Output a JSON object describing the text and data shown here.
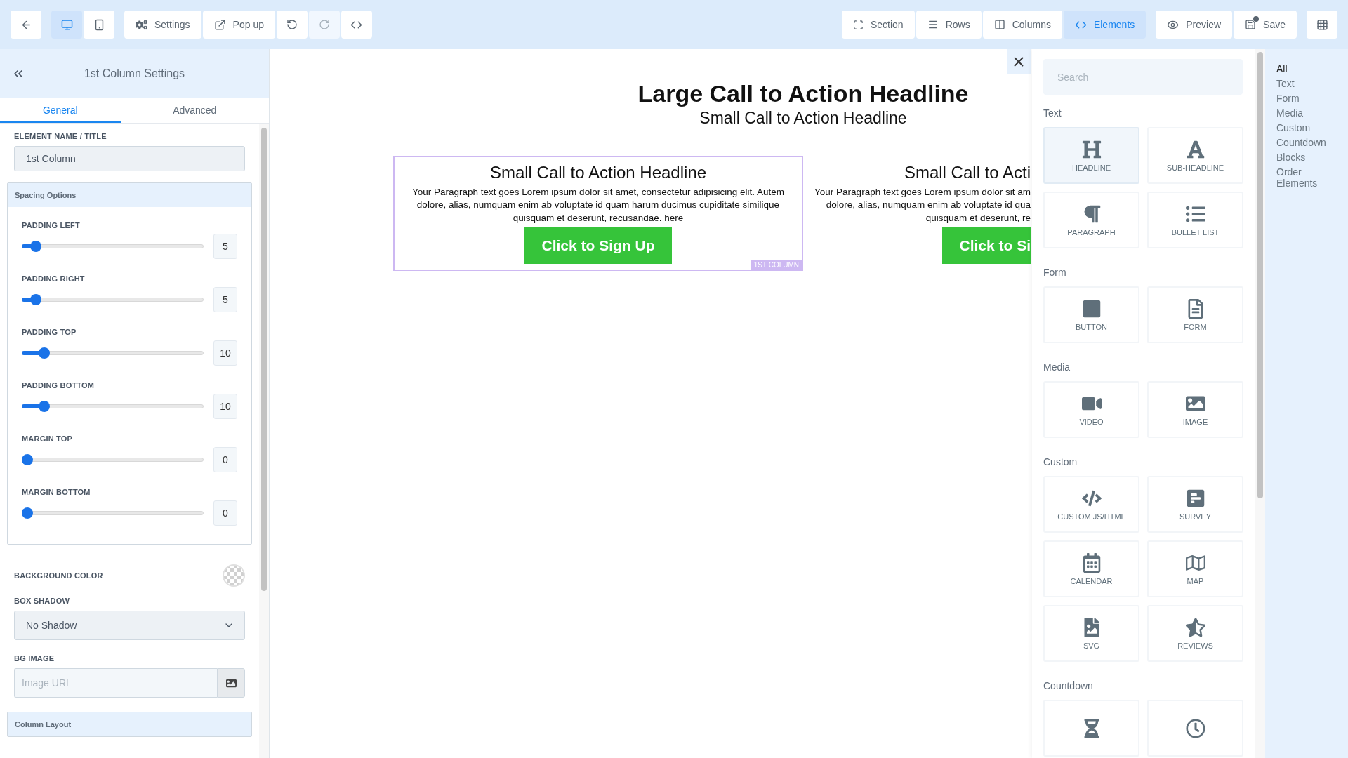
{
  "toolbar": {
    "devices": [
      {
        "kind": "desktop",
        "selected": true
      },
      {
        "kind": "mobile",
        "selected": false
      }
    ],
    "actions": [
      {
        "kind": "settings",
        "label": "Settings",
        "disabled": false
      },
      {
        "kind": "popup",
        "label": "Pop up",
        "disabled": false
      },
      {
        "kind": "undo",
        "disabled": false
      },
      {
        "kind": "redo",
        "disabled": true
      },
      {
        "kind": "code",
        "disabled": false
      }
    ],
    "modes": [
      {
        "kind": "section",
        "label": "Section",
        "selected": false
      },
      {
        "kind": "rows",
        "label": "Rows",
        "selected": false
      },
      {
        "kind": "columns",
        "label": "Columns",
        "selected": false
      },
      {
        "kind": "elements",
        "label": "Elements",
        "selected": true
      }
    ],
    "preview": {
      "label": "Preview"
    },
    "save": {
      "label": "Save",
      "unsaved": true
    }
  },
  "sidebar": {
    "title": "1st Column Settings",
    "tabs": [
      {
        "label": "General",
        "selected": true
      },
      {
        "label": "Advanced",
        "selected": false
      }
    ],
    "name_field": {
      "label": "ELEMENT NAME / TITLE",
      "value": "1st Column"
    },
    "spacing": {
      "title": "Spacing Options",
      "sliders": [
        {
          "label": "PADDING LEFT",
          "level": 0.05,
          "value": "5"
        },
        {
          "label": "PADDING RIGHT",
          "level": 0.05,
          "value": "5"
        },
        {
          "label": "PADDING TOP",
          "level": 0.1,
          "value": "10"
        },
        {
          "label": "PADDING BOTTOM",
          "level": 0.1,
          "value": "10"
        },
        {
          "label": "MARGIN TOP",
          "level": 0,
          "value": "0"
        },
        {
          "label": "MARGIN BOTTOM",
          "level": 0,
          "value": "0"
        }
      ]
    },
    "background_color": {
      "label": "BACKGROUND COLOR"
    },
    "box_shadow": {
      "label": "BOX SHADOW",
      "value": "No Shadow"
    },
    "bg_image": {
      "label": "BG IMAGE",
      "placeholder": "Image URL"
    },
    "column_layout": {
      "title": "Column Layout"
    }
  },
  "canvas": {
    "headline": "Large Call to Action Headline",
    "subheadline": "Small Call to Action Headline",
    "columns": [
      {
        "selected": true,
        "tag": "1ST COLUMN",
        "headline": "Small Call to Action Headline",
        "paragraph_lines": [
          "Your Paragraph text goes Lorem ipsum dolor sit amet, consectetur adipisicing elit. Autem",
          "dolore, alias, numquam enim ab voluptate id quam harum ducimus cupiditate similique",
          "quisquam et deserunt, recusandae. here"
        ],
        "button": "Click to Sign Up"
      },
      {
        "selected": false,
        "headline": "Small Call to Acti",
        "paragraph_lines": [
          "Your Paragraph text goes Lorem ipsum dolor sit am",
          "dolore, alias, numquam enim ab voluptate id qua",
          "quisquam et deserunt, re"
        ],
        "button": "Click to Si"
      }
    ]
  },
  "elements_panel": {
    "search": {
      "placeholder": "Search"
    },
    "groups": [
      {
        "title": "Text",
        "items": [
          {
            "kind": "headline",
            "label": "HEADLINE",
            "selected": true
          },
          {
            "kind": "subheadline",
            "label": "SUB-HEADLINE",
            "selected": false
          },
          {
            "kind": "paragraph",
            "label": "PARAGRAPH",
            "selected": false
          },
          {
            "kind": "bullets",
            "label": "BULLET LIST",
            "selected": false
          }
        ]
      },
      {
        "title": "Form",
        "items": [
          {
            "kind": "button",
            "label": "BUTTON",
            "selected": false
          },
          {
            "kind": "form",
            "label": "FORM",
            "selected": false
          }
        ]
      },
      {
        "title": "Media",
        "items": [
          {
            "kind": "video",
            "label": "VIDEO",
            "selected": false
          },
          {
            "kind": "image",
            "label": "IMAGE",
            "selected": false
          }
        ]
      },
      {
        "title": "Custom",
        "items": [
          {
            "kind": "code",
            "label": "CUSTOM JS/HTML",
            "selected": false
          },
          {
            "kind": "survey",
            "label": "SURVEY",
            "selected": false
          },
          {
            "kind": "calendar",
            "label": "CALENDAR",
            "selected": false
          },
          {
            "kind": "map",
            "label": "MAP",
            "selected": false
          },
          {
            "kind": "svg",
            "label": "SVG",
            "selected": false
          },
          {
            "kind": "reviews",
            "label": "REVIEWS",
            "selected": false
          }
        ]
      },
      {
        "title": "Countdown",
        "items": [
          {
            "kind": "hourglass",
            "selected": false
          },
          {
            "kind": "clock",
            "selected": false
          }
        ]
      }
    ],
    "categories": [
      {
        "label": "All",
        "selected": true
      },
      {
        "label": "Text",
        "selected": false
      },
      {
        "label": "Form",
        "selected": false
      },
      {
        "label": "Media",
        "selected": false
      },
      {
        "label": "Custom",
        "selected": false
      },
      {
        "label": "Countdown",
        "selected": false
      },
      {
        "label": "Blocks",
        "selected": false
      },
      {
        "label": "Order Elements",
        "selected": false
      }
    ]
  }
}
